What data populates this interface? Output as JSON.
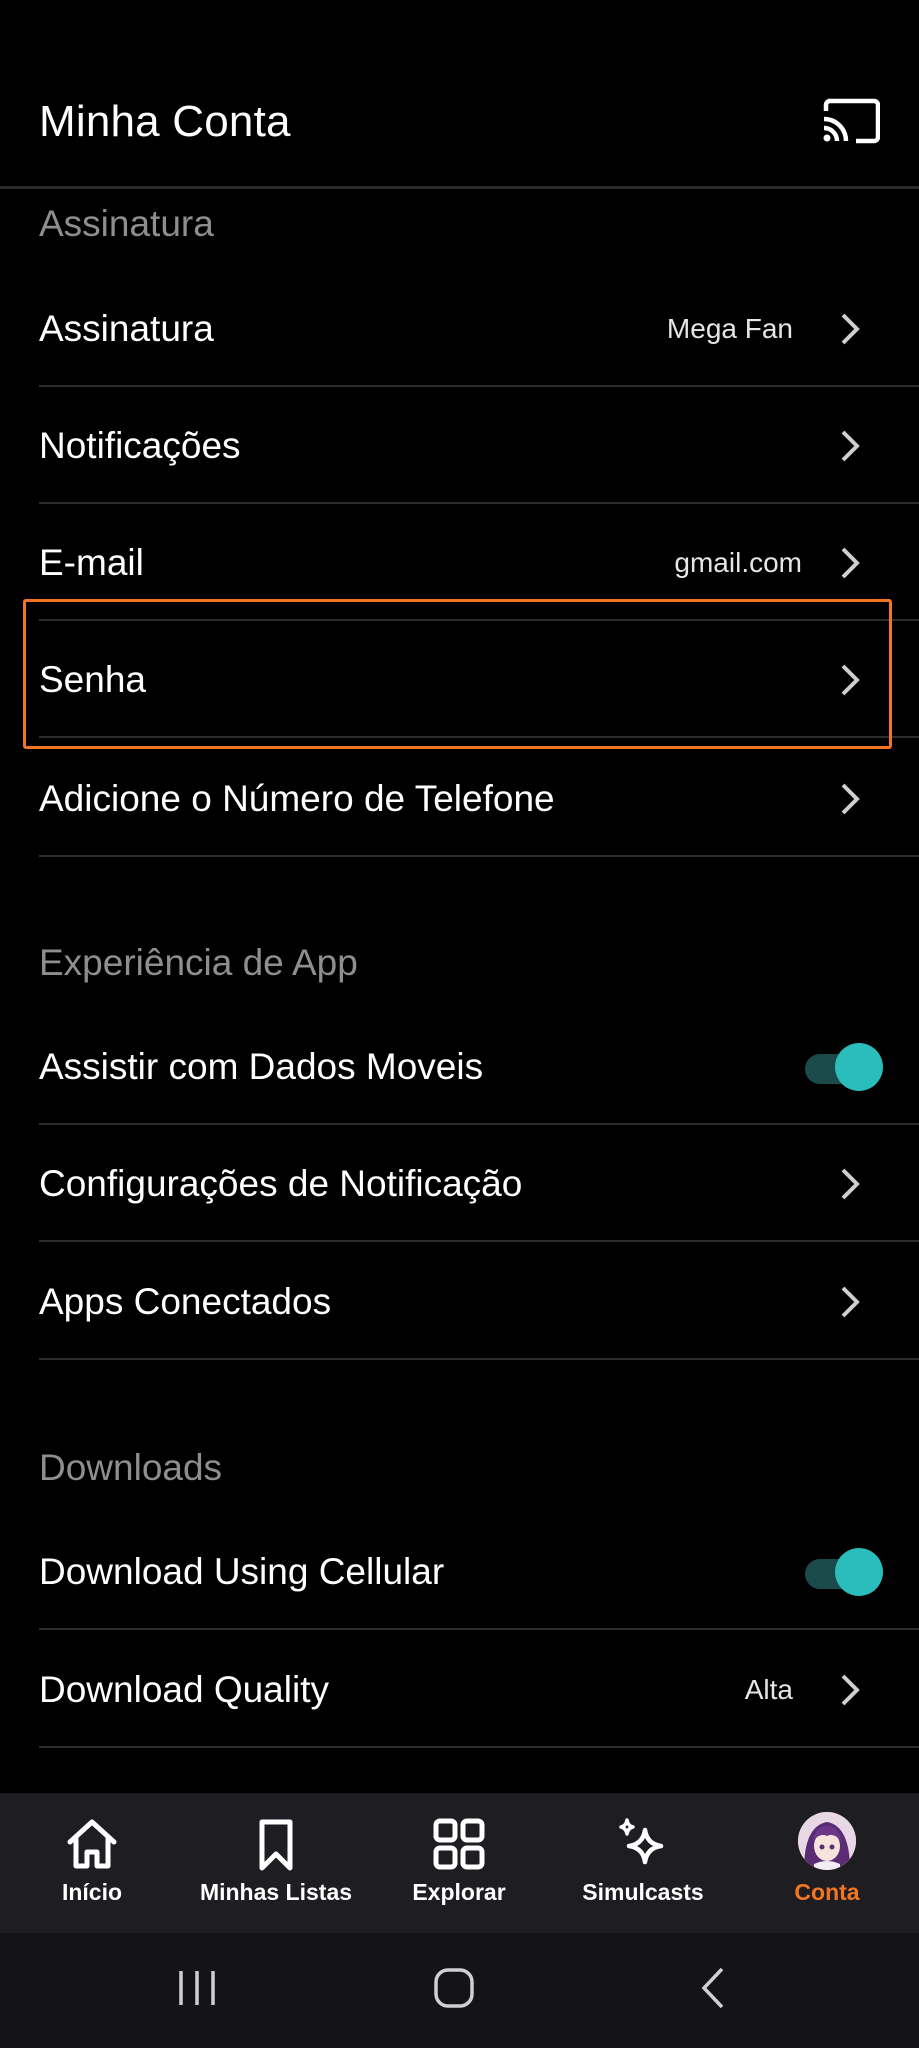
{
  "header": {
    "title": "Minha Conta",
    "cast_icon": "cast-icon"
  },
  "sections": {
    "subscription": {
      "title": "Assinatura"
    },
    "app_experience": {
      "title": "Experiência de App"
    },
    "downloads": {
      "title": "Downloads"
    }
  },
  "rows": {
    "assinatura": {
      "label": "Assinatura",
      "value": "Mega Fan"
    },
    "notificacoes": {
      "label": "Notificações"
    },
    "email": {
      "label": "E-mail",
      "value": "gmail.com"
    },
    "senha": {
      "label": "Senha"
    },
    "telefone": {
      "label": "Adicione o Número de Telefone"
    },
    "dados_moveis": {
      "label": "Assistir com Dados Moveis",
      "toggle_on": true
    },
    "config_notificacao": {
      "label": "Configurações de Notificação"
    },
    "apps_conectados": {
      "label": "Apps Conectados"
    },
    "download_cellular": {
      "label": "Download Using Cellular",
      "toggle_on": true
    },
    "download_quality": {
      "label": "Download Quality",
      "value": "Alta"
    }
  },
  "bottom_nav": {
    "items": [
      {
        "label": "Início",
        "icon": "home-icon"
      },
      {
        "label": "Minhas Listas",
        "icon": "bookmark-icon"
      },
      {
        "label": "Explorar",
        "icon": "grid-icon"
      },
      {
        "label": "Simulcasts",
        "icon": "sparkle-icon"
      },
      {
        "label": "Conta",
        "icon": "avatar",
        "active": true
      }
    ]
  },
  "colors": {
    "accent": "#f47521",
    "toggle": "#2abdbb",
    "background": "#000000",
    "section_title": "#8e8e8e"
  }
}
